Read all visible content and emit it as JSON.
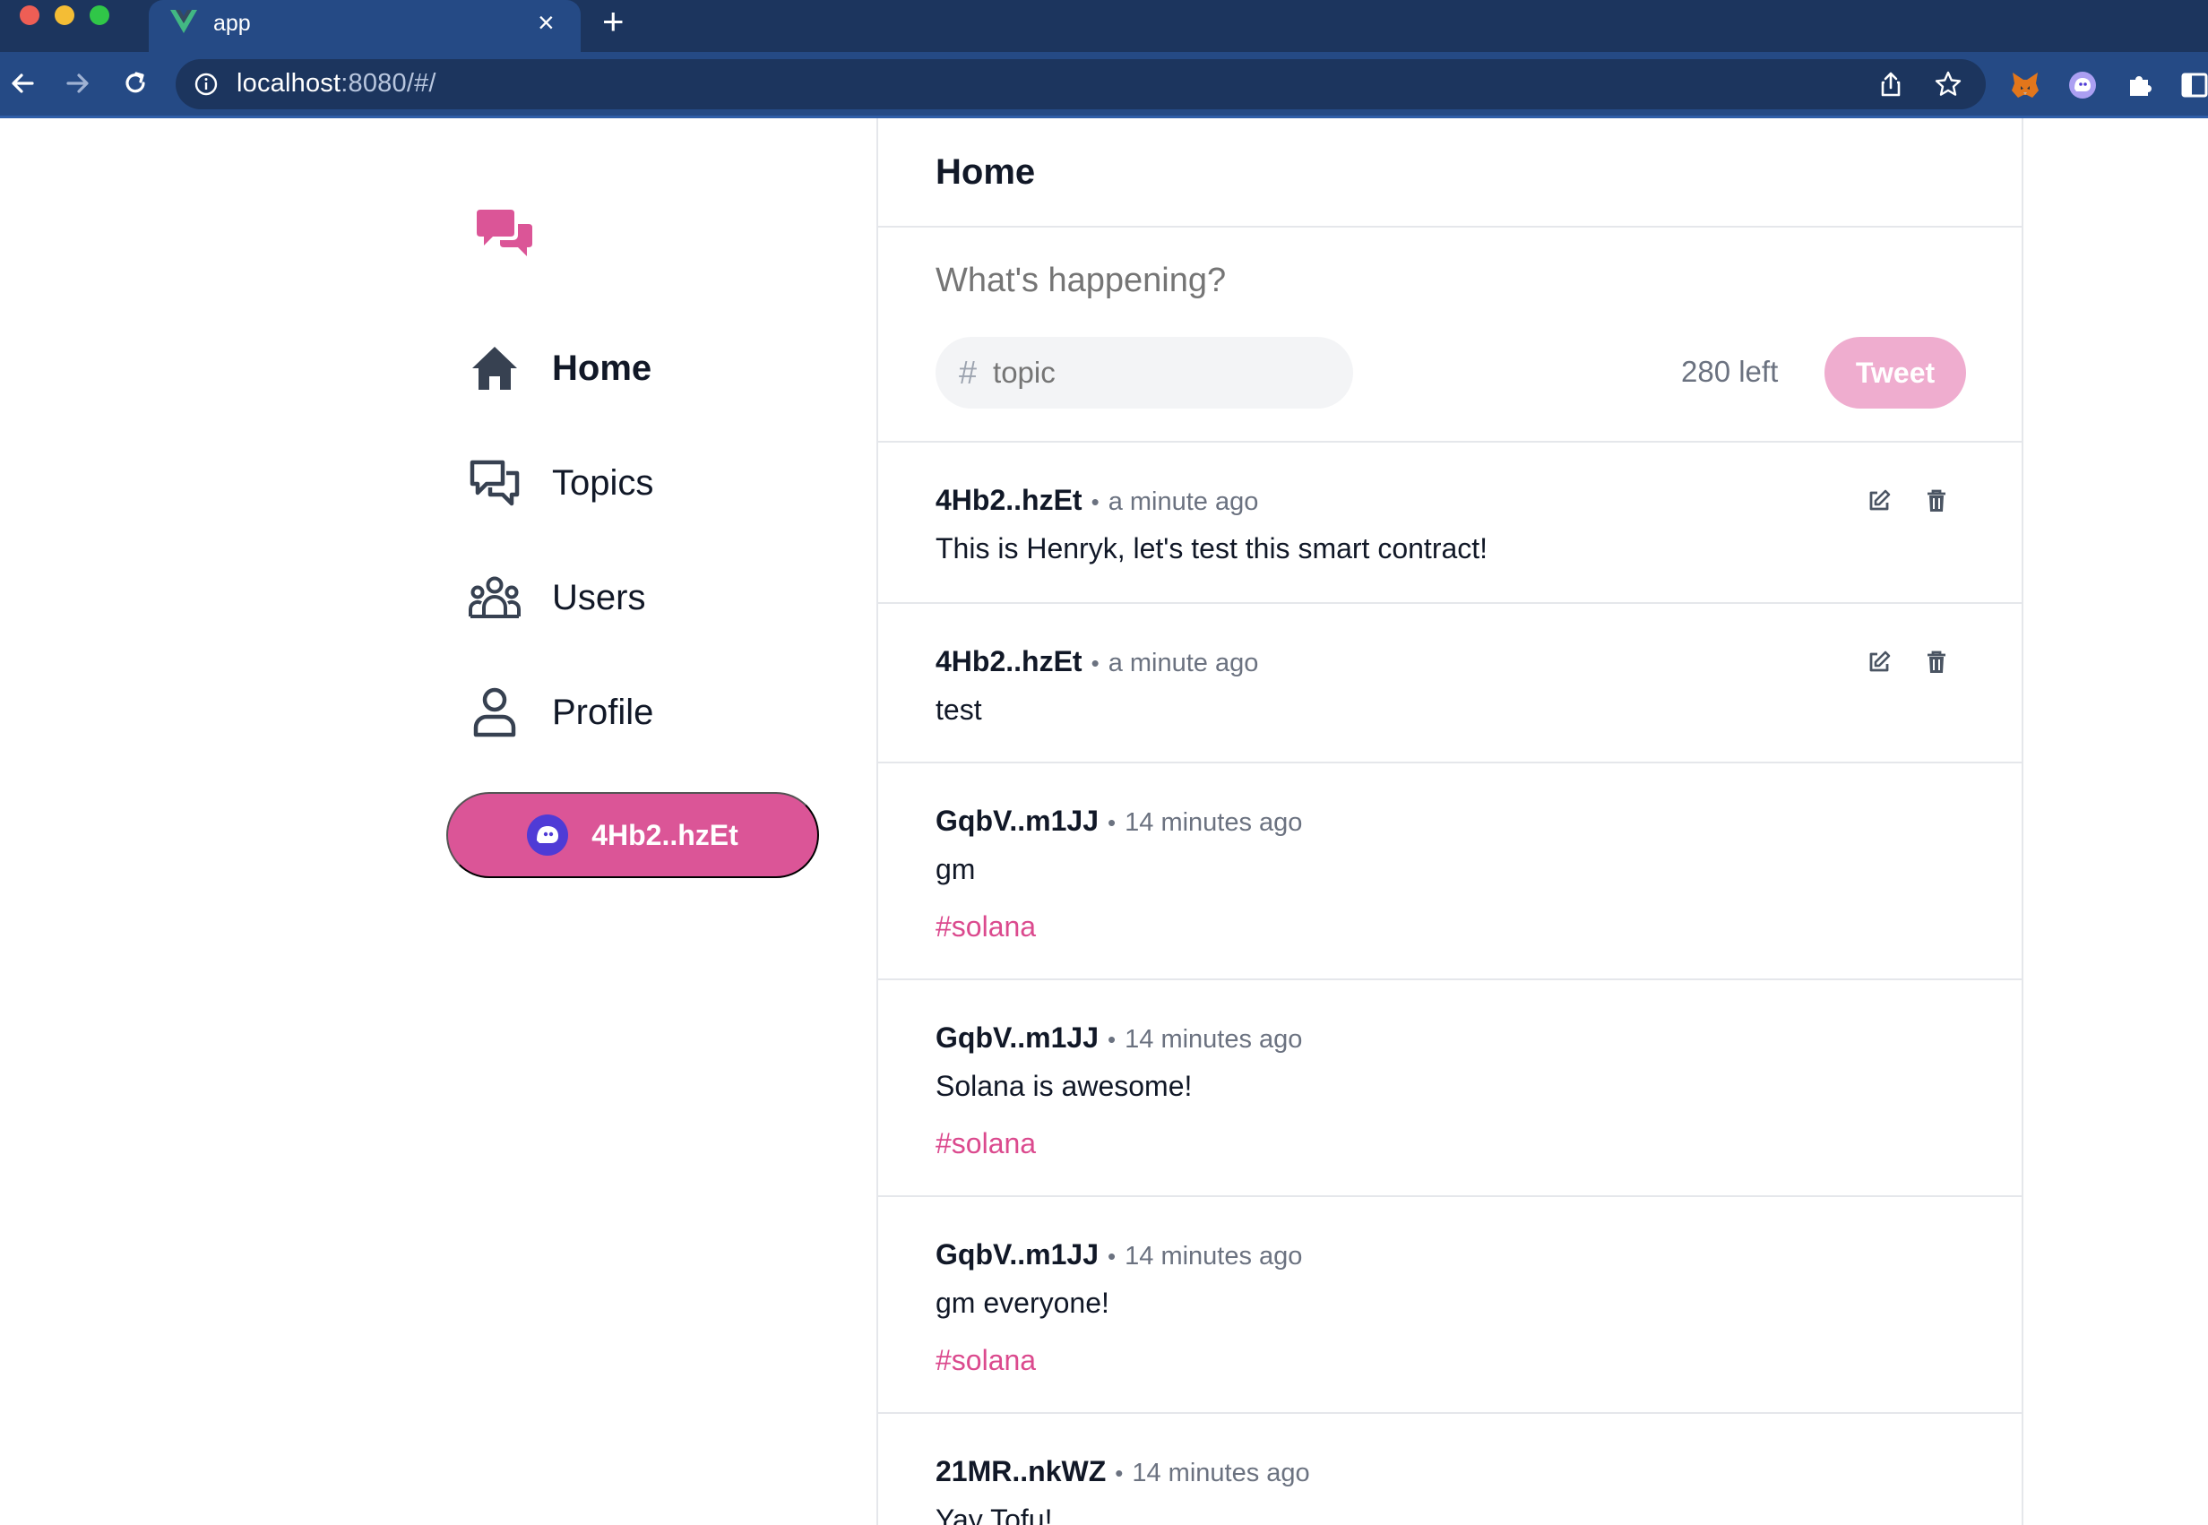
{
  "browser": {
    "tab_title": "app",
    "url_host": "localhost",
    "url_rest": ":8080/#/"
  },
  "sidebar": {
    "items": [
      {
        "label": "Home",
        "icon": "home-icon"
      },
      {
        "label": "Topics",
        "icon": "chat-bubbles-icon"
      },
      {
        "label": "Users",
        "icon": "users-icon"
      },
      {
        "label": "Profile",
        "icon": "user-icon"
      }
    ],
    "wallet_label": "4Hb2..hzEt"
  },
  "main": {
    "title": "Home",
    "composer": {
      "placeholder": "What's happening?",
      "topic_placeholder": "topic",
      "topic_prefix": "#",
      "chars_left": "280 left",
      "tweet_label": "Tweet"
    },
    "tweets": [
      {
        "author": "4Hb2..hzEt",
        "separator": "•",
        "time": "a minute ago",
        "content": "This is Henryk, let's test this smart contract!",
        "topic": ""
      },
      {
        "author": "4Hb2..hzEt",
        "separator": "•",
        "time": "a minute ago",
        "content": "test",
        "topic": ""
      },
      {
        "author": "GqbV..m1JJ",
        "separator": "•",
        "time": "14 minutes ago",
        "content": "gm",
        "topic": "#solana"
      },
      {
        "author": "GqbV..m1JJ",
        "separator": "•",
        "time": "14 minutes ago",
        "content": "Solana is awesome!",
        "topic": "#solana"
      },
      {
        "author": "GqbV..m1JJ",
        "separator": "•",
        "time": "14 minutes ago",
        "content": "gm everyone!",
        "topic": "#solana"
      },
      {
        "author": "21MR..nkWZ",
        "separator": "•",
        "time": "14 minutes ago",
        "content": "Yay Tofu!",
        "topic": ""
      }
    ]
  },
  "colors": {
    "brand_pink": "#db5597",
    "topic_pink": "#db4a8e",
    "tweet_button_disabled": "#efadcf",
    "chrome_dark": "#1c355e",
    "chrome_tab": "#254a85"
  }
}
